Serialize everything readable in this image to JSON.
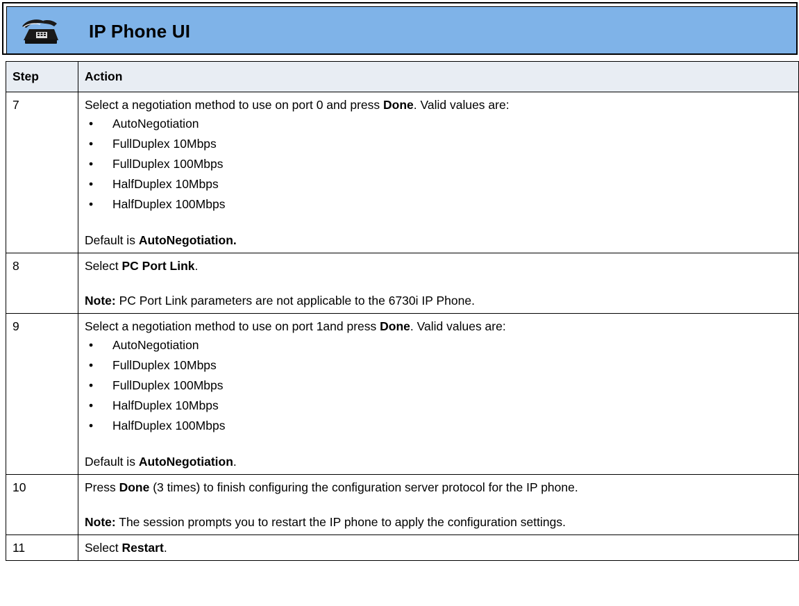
{
  "banner": {
    "title": "IP Phone UI",
    "icon": "phone-icon",
    "background_color": "#7fb3e8"
  },
  "table": {
    "headers": {
      "step": "Step",
      "action": "Action"
    },
    "header_background": "#e8edf3",
    "rows": [
      {
        "step": "7",
        "intro_before": "Select a negotiation method to use on port 0 and press ",
        "intro_bold": "Done",
        "intro_after": ". Valid values are:",
        "values": [
          "AutoNegotiation",
          "FullDuplex 10Mbps",
          "FullDuplex 100Mbps",
          "HalfDuplex 10Mbps",
          "HalfDuplex 100Mbps"
        ],
        "default_prefix": "Default is ",
        "default_bold": "AutoNegotiation.",
        "default_suffix": ""
      },
      {
        "step": "8",
        "line1_before": "Select ",
        "line1_bold": "PC Port Link",
        "line1_after": ".",
        "note_label": "Note:",
        "note_text": " PC Port Link parameters are not applicable to the 6730i IP Phone."
      },
      {
        "step": "9",
        "intro_before": "Select a negotiation method to use on port 1and press ",
        "intro_bold": "Done",
        "intro_after": ". Valid values are:",
        "values": [
          "AutoNegotiation",
          "FullDuplex 10Mbps",
          "FullDuplex 100Mbps",
          "HalfDuplex 10Mbps",
          "HalfDuplex 100Mbps"
        ],
        "default_prefix": "Default is ",
        "default_bold": "AutoNegotiation",
        "default_suffix": "."
      },
      {
        "step": "10",
        "line1_before": "Press ",
        "line1_bold": "Done",
        "line1_after": " (3 times) to finish configuring the configuration server protocol for the IP phone.",
        "note_label": "Note:",
        "note_text": " The session prompts you to restart the IP phone to apply the configuration settings."
      },
      {
        "step": "11",
        "line1_before": "Select ",
        "line1_bold": "Restart",
        "line1_after": "."
      }
    ]
  },
  "bullet_glyph": "•"
}
